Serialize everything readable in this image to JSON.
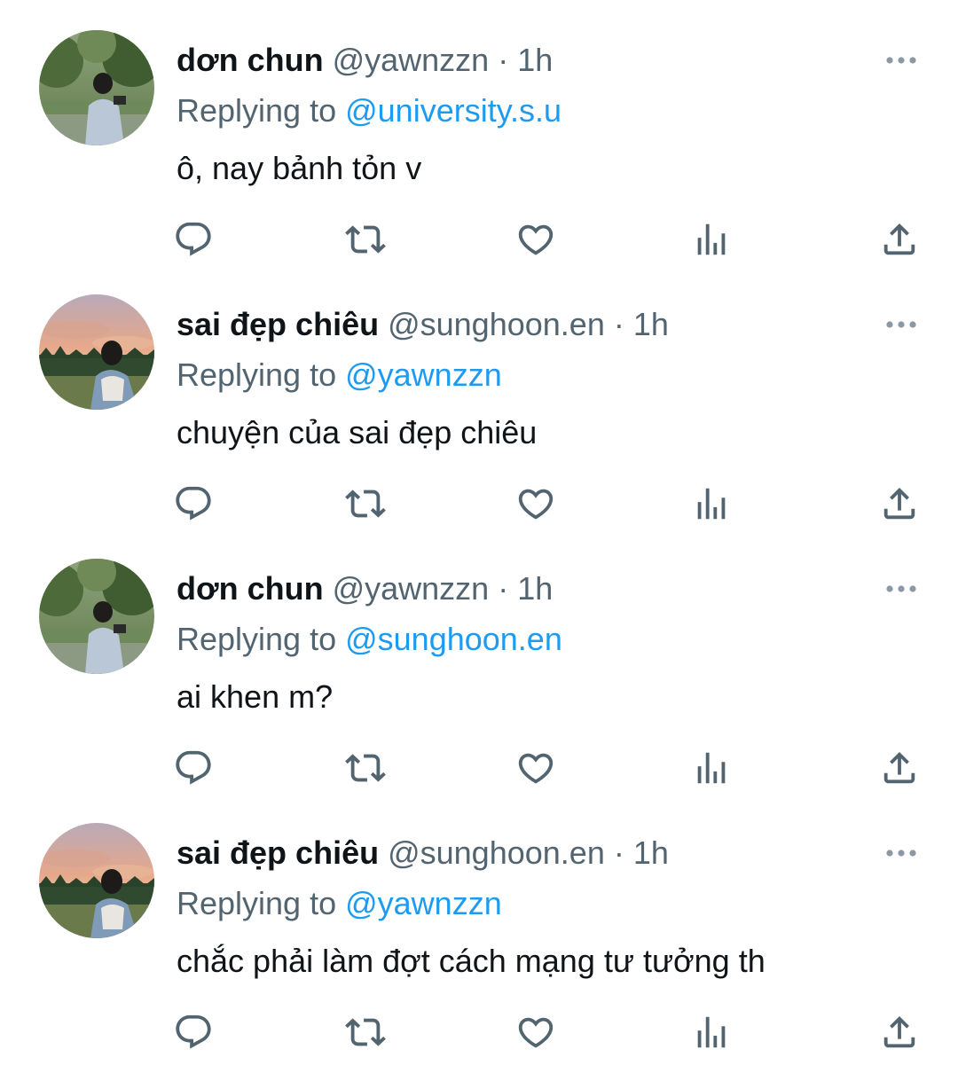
{
  "tweets": [
    {
      "avatar": "avatar-park-photo",
      "name": "dơn chun",
      "handle": "@yawnzzn",
      "separator": "·",
      "time": "1h",
      "replying_prefix": "Replying to ",
      "replying_to": "@university.s.u",
      "text": "ô, nay bảnh tỏn v"
    },
    {
      "avatar": "avatar-sunset-photo",
      "name": "sai đẹp chiêu",
      "handle": "@sunghoon.en",
      "separator": "·",
      "time": "1h",
      "replying_prefix": "Replying to ",
      "replying_to": "@yawnzzn",
      "text": "chuyện của sai đẹp chiêu"
    },
    {
      "avatar": "avatar-park-photo",
      "name": "dơn chun",
      "handle": "@yawnzzn",
      "separator": "·",
      "time": "1h",
      "replying_prefix": "Replying to ",
      "replying_to": "@sunghoon.en",
      "text": "ai khen m?"
    },
    {
      "avatar": "avatar-sunset-photo",
      "name": "sai đẹp chiêu",
      "handle": "@sunghoon.en",
      "separator": "·",
      "time": "1h",
      "replying_prefix": "Replying to ",
      "replying_to": "@yawnzzn",
      "text": "chắc phải làm đợt cách mạng tư tưởng th"
    }
  ],
  "icons": {
    "reply": "reply-icon",
    "retweet": "retweet-icon",
    "like": "heart-icon",
    "views": "views-icon",
    "share": "share-icon",
    "more": "more-icon"
  },
  "colors": {
    "text_primary": "#0f1419",
    "text_secondary": "#536471",
    "mention": "#1d9bf0",
    "background": "#ffffff"
  }
}
